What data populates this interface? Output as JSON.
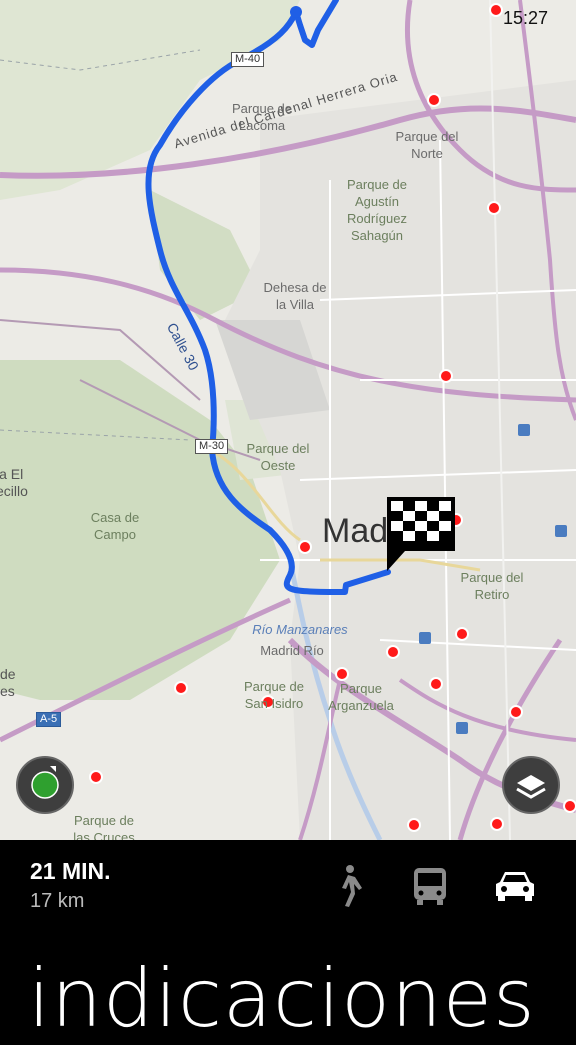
{
  "status": {
    "time": "15:27"
  },
  "map": {
    "roads": [
      {
        "label": "M-40",
        "type": "shield"
      },
      {
        "label": "M-30",
        "type": "shield"
      },
      {
        "label": "A-5",
        "type": "shield-blue"
      },
      {
        "label": "Avenida del Cardenal Herrera Oria",
        "type": "street"
      },
      {
        "label": "Calle 30",
        "type": "street"
      }
    ],
    "places": [
      "Parque de\nLacoma",
      "Parque del\nNorte",
      "Parque de\nAgustín\nRodríguez\nSahagún",
      "Dehesa de\nla Villa",
      "Parque del\nOeste",
      "Casa de\nCampo",
      "ia El\necillo",
      "Parque del\nRetiro",
      "Madrid Río",
      "Parque de\nSan Isidro",
      "Parque\nArganzuela",
      "de\nes",
      "Parque de\nlas Cruces"
    ],
    "water": "Río Manzanares",
    "city": "Madrid",
    "city_visible": "Mad",
    "route_color": "#1f5fe6",
    "accent": "#ff1a1a"
  },
  "controls": {
    "locate": "location-button",
    "layers": "layers-button"
  },
  "summary": {
    "duration": "21 MIN.",
    "distance": "17 km"
  },
  "modes": [
    {
      "name": "walk",
      "icon": "walking-icon",
      "selected": false
    },
    {
      "name": "transit",
      "icon": "bus-icon",
      "selected": false
    },
    {
      "name": "drive",
      "icon": "car-icon",
      "selected": true
    }
  ],
  "title": "indicaciones"
}
